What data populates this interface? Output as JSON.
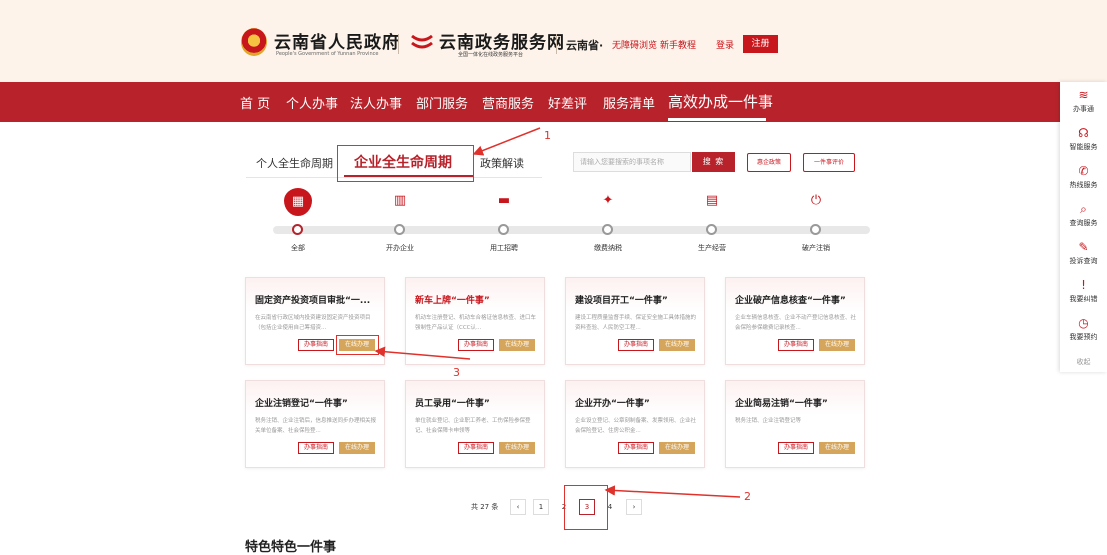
{
  "header": {
    "gov_name": "云南省人民政府",
    "gov_sub": "People's Government of Yunnan Province",
    "svc_name": "云南政务服务网",
    "svc_sub": "全国一体化在线政务服务平台",
    "region": "云南省·",
    "accessible": "无障碍浏览",
    "tutorial": "新手教程",
    "login": "登录",
    "register": "注册"
  },
  "nav": {
    "items": [
      "首 页",
      "个人办事",
      "法人办事",
      "部门服务",
      "营商服务",
      "好差评",
      "服务清单",
      "高效办成一件事"
    ]
  },
  "sidebar": {
    "items": [
      {
        "icon": "≋",
        "label": "办事通"
      },
      {
        "icon": "☊",
        "label": "智能服务"
      },
      {
        "icon": "✆",
        "label": "热线服务"
      },
      {
        "icon": "⌕",
        "label": "查询服务"
      },
      {
        "icon": "✎",
        "label": "投诉查询"
      },
      {
        "icon": "!",
        "label": "我要纠错"
      },
      {
        "icon": "◷",
        "label": "我要预约"
      }
    ],
    "collapse": "收起"
  },
  "tabs": {
    "personal": "个人全生命周期",
    "enterprise": "企业全生命周期",
    "policy": "政策解读"
  },
  "search": {
    "placeholder": "请输入您要搜索的事项名称",
    "button": "搜 索",
    "btn_policy": "惠企政策",
    "btn_eval": "一件事评价"
  },
  "stages": {
    "items": [
      {
        "icon": "▦",
        "label": "全部"
      },
      {
        "icon": "▥",
        "label": "开办企业"
      },
      {
        "icon": "▬",
        "label": "用工招聘"
      },
      {
        "icon": "✦",
        "label": "缴费纳税"
      },
      {
        "icon": "▤",
        "label": "生产经营"
      },
      {
        "icon": "⏻",
        "label": "破产注销"
      }
    ]
  },
  "cards": {
    "guide_label": "办事指南",
    "online_label": "在线办理",
    "items": [
      {
        "title": "固定资产投资项目审批“一...",
        "desc": "在云南省行政区域内投资建设固定资产投资项目（包括企业使用自己筹措资..."
      },
      {
        "title": "新车上牌“一件事”",
        "desc": "机动车注册登记、机动车合格证信息核查、进口车强制性产品认证（CCC认..."
      },
      {
        "title": "建设项目开工“一件事”",
        "desc": "建设工程质量监督手续、保证安全施工具体措施的资料查验、人民防空工程..."
      },
      {
        "title": "企业破产信息核查“一件事”",
        "desc": "企业车辆信息核查、企业不动产登记信息核查、社会保险参保缴费记录核查..."
      },
      {
        "title": "企业注销登记“一件事”",
        "desc": "税务注销、企业注销后，信息推送同步办理相关报关单位备案、社会保险登..."
      },
      {
        "title": "员工录用“一件事”",
        "desc": "单位就业登记、企业职工养老、工伤保险参保登记、社会保障卡申领等"
      },
      {
        "title": "企业开办“一件事”",
        "desc": "企业设立登记、公章刻制备案、发票领用、企业社会保险登记、住房公积金..."
      },
      {
        "title": "企业简易注销“一件事”",
        "desc": "税务注销、企业注销登记等"
      }
    ]
  },
  "annotations": {
    "n1": "1",
    "n2": "2",
    "n3": "3"
  },
  "pager": {
    "total": "共 27 条",
    "prev": "‹",
    "pages": [
      "1",
      "2",
      "3",
      "4"
    ],
    "next": "›"
  },
  "bottom": {
    "title": "特色特色一件事"
  }
}
